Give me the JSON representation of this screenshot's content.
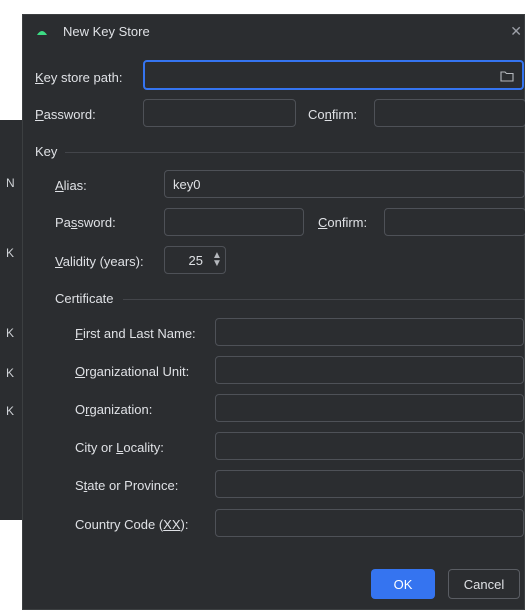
{
  "window": {
    "title": "New Key Store"
  },
  "background": {
    "letters": [
      "N",
      "K",
      "K",
      "K",
      "K"
    ]
  },
  "keystore": {
    "path_label_pre": "K",
    "path_label_rest": "ey store path:",
    "path_value": "",
    "password_label_pre": "P",
    "password_label_rest": "assword:",
    "password_value": "",
    "confirm_label_pre": "Co",
    "confirm_label_u": "n",
    "confirm_label_rest": "firm:",
    "confirm_value": ""
  },
  "key": {
    "section_label": "Key",
    "alias_label_pre": "A",
    "alias_label_rest": "lias:",
    "alias_value": "key0",
    "password_label_pre": "Pa",
    "password_label_u": "s",
    "password_label_rest": "sword:",
    "password_value": "",
    "confirm_label_pre": "C",
    "confirm_label_rest": "onfirm:",
    "confirm_value": "",
    "validity_label_pre": "V",
    "validity_label_rest": "alidity (years):",
    "validity_value": "25"
  },
  "certificate": {
    "section_label": "Certificate",
    "fields": [
      {
        "label_pre": "",
        "label_u": "F",
        "label_rest": "irst and Last Name:",
        "value": ""
      },
      {
        "label_pre": "",
        "label_u": "O",
        "label_rest": "rganizational Unit:",
        "value": ""
      },
      {
        "label_pre": "O",
        "label_u": "r",
        "label_rest": "ganization:",
        "value": ""
      },
      {
        "label_pre": "City or ",
        "label_u": "L",
        "label_rest": "ocality:",
        "value": ""
      },
      {
        "label_pre": "S",
        "label_u": "t",
        "label_rest": "ate or Province:",
        "value": ""
      },
      {
        "label_pre": "Country Code (",
        "label_u": "XX",
        "label_rest": "):",
        "value": ""
      }
    ]
  },
  "buttons": {
    "ok": "OK",
    "cancel": "Cancel"
  },
  "colors": {
    "accent": "#3574f0",
    "background": "#2b2d30",
    "border": "#4e5157"
  }
}
